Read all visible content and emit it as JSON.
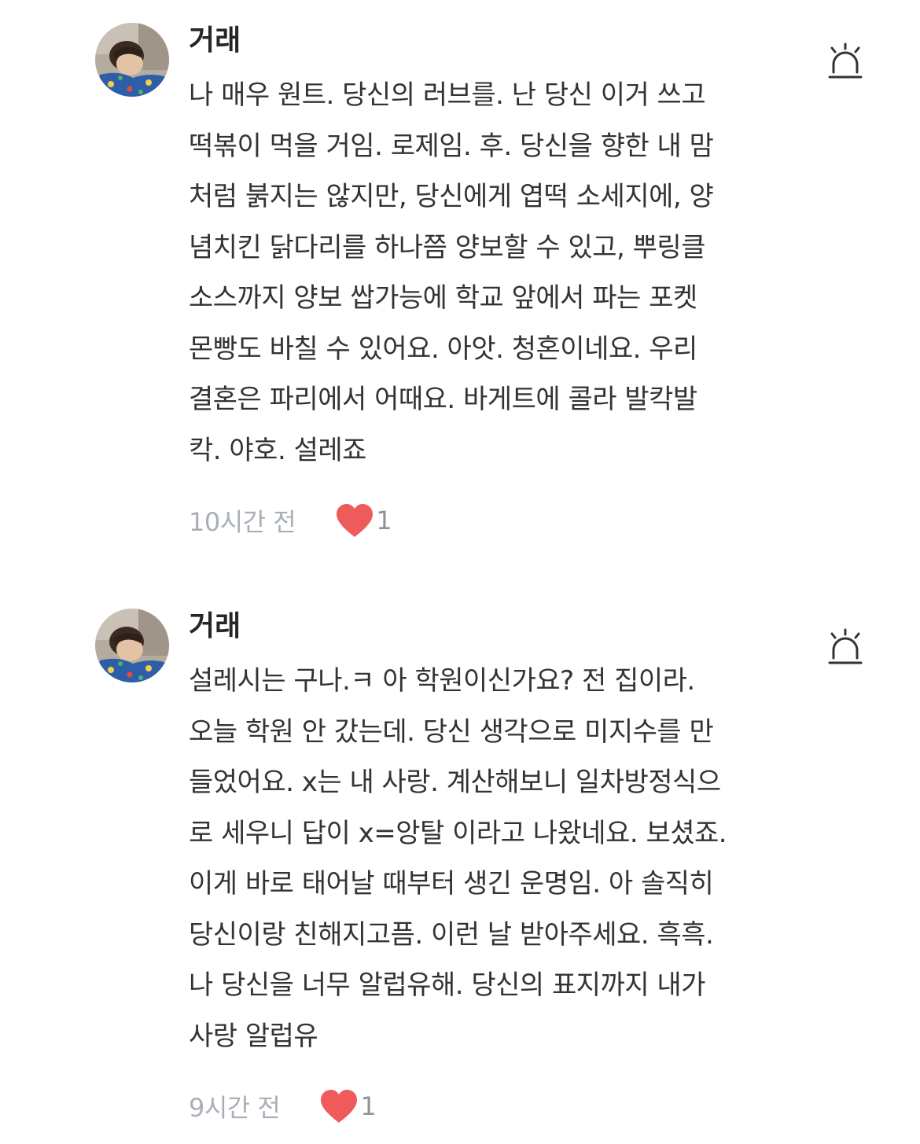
{
  "comments": [
    {
      "author": "거래",
      "avatar": "avatar",
      "lines": [
        "나 매우 원트. 당신의 러브를. 난 당신 이거 쓰고",
        "떡볶이 먹을 거임. 로제임. 후. 당신을 향한 내 맘",
        "처럼 붉지는 않지만, 당신에게 엽떡 소세지에, 양",
        "념치킨 닭다리를 하나쯤 양보할 수 있고, 뿌링클",
        "소스까지 양보 쌉가능에 학교 앞에서 파는 포켓",
        "몬빵도 바칠 수 있어요. 아앗. 청혼이네요. 우리",
        "결혼은 파리에서 어때요. 바게트에 콜라 발칵발",
        "칵. 야호. 설레죠"
      ],
      "time": "10시간 전",
      "likes": "1"
    },
    {
      "author": "거래",
      "avatar": "avatar",
      "lines": [
        "설레시는 구나.ㅋ 아 학원이신가요? 전 집이라.",
        "오늘 학원 안 갔는데. 당신 생각으로 미지수를 만",
        "들었어요. x는 내 사랑. 계산해보니 일차방정식으",
        "로 세우니 답이 x=앙탈 이라고 나왔네요. 보셨죠.",
        "이게 바로 태어날 때부터 생긴 운명임. 아 솔직히",
        "당신이랑 친해지고픔. 이런 날 받아주세요. 흑흑.",
        "나 당신을 너무 알럽유해. 당신의 표지까지 내가",
        "사랑 알럽유"
      ],
      "time": "9시간 전",
      "likes": "1"
    }
  ],
  "icons": {
    "report": "siren-icon",
    "like": "heart-icon"
  },
  "colors": {
    "heart": "#ef5a5a",
    "meta_text": "#a9afb8",
    "icon_stroke": "#333333"
  }
}
